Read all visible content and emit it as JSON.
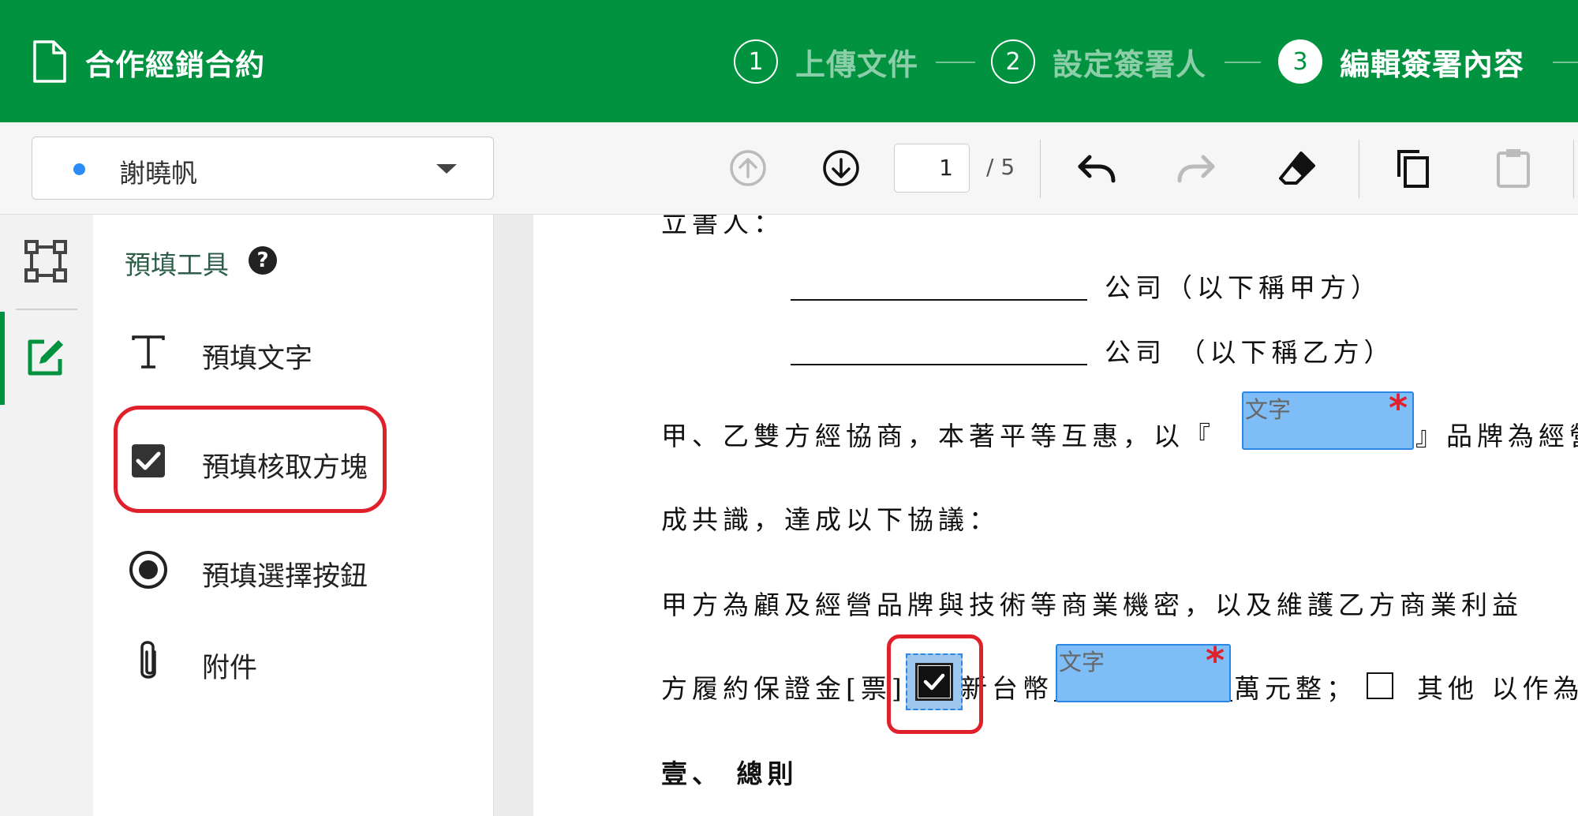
{
  "header": {
    "doc_title": "合作經銷合約",
    "steps": [
      {
        "number": "1",
        "label": "上傳文件",
        "state": "done"
      },
      {
        "number": "2",
        "label": "設定簽署人",
        "state": "done"
      },
      {
        "number": "3",
        "label": "編輯簽署內容",
        "state": "active"
      }
    ]
  },
  "toolbar": {
    "signer_name": "謝曉帆",
    "signer_color": "#2a8cf4",
    "current_page": "1",
    "total_pages": "/ 5",
    "buttons": [
      "prev-page-icon",
      "next-page-icon",
      "undo-icon",
      "redo-icon",
      "eraser-icon",
      "copy-icon",
      "paste-icon"
    ]
  },
  "panel": {
    "title": "預填工具",
    "tools": [
      {
        "label": "預填文字",
        "icon": "text-icon"
      },
      {
        "label": "預填核取方塊",
        "icon": "checkbox-icon"
      },
      {
        "label": "預填選擇按鈕",
        "icon": "radio-icon"
      },
      {
        "label": "附件",
        "icon": "paperclip-icon"
      }
    ]
  },
  "document": {
    "line0": "立書人：",
    "party_a": "公司（以下稱甲方）",
    "party_b": "公司 （以下稱乙方）",
    "para1_start": "甲、乙雙方經協商，本著平等互惠，以『",
    "para1_end": "』品牌為經營",
    "para2": "成共識，達成以下協議：",
    "para3": "甲方為顧及經營品牌與技術等商業機密，以及維護乙方商業利益",
    "para4_start": "方履約保證金[票]",
    "para4_mid": "新台幣",
    "para4_end": "萬元整；",
    "para4_other": "其他  以作為",
    "section": "壹、    總則",
    "field_placeholder": "文字",
    "required_mark": "*"
  },
  "colors": {
    "brand_green": "#00923f",
    "highlight_red": "#e0202a",
    "field_blue": "#7fbdf7"
  }
}
